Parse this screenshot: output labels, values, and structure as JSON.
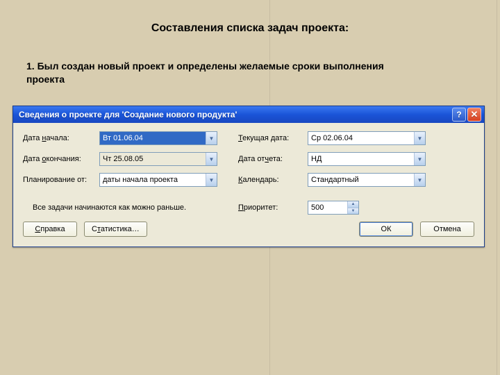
{
  "slide": {
    "title": "Составления списка задач проекта:",
    "subtitle": "1. Был создан новый проект и определены желаемые сроки выполнения проекта"
  },
  "dialog": {
    "title": "Сведения о проекте для 'Создание нового продукта'",
    "help_glyph": "?",
    "close_glyph": "✕",
    "labels": {
      "start_date_pre": "Дата ",
      "start_date_u": "н",
      "start_date_post": "ачала:",
      "end_date_pre": "Дата ",
      "end_date_u": "о",
      "end_date_post": "кончания:",
      "plan_from": "Планирование от:",
      "current_date_pre": "",
      "current_date_u": "Т",
      "current_date_post": "екущая дата:",
      "report_date_pre": "Дата от",
      "report_date_u": "ч",
      "report_date_post": "ета:",
      "calendar_u": "К",
      "calendar_post": "алендарь:",
      "priority_u": "П",
      "priority_post": "риоритет:"
    },
    "values": {
      "start_date": "Вт 01.06.04",
      "end_date": "Чт 25.08.05",
      "plan_from": "даты начала проекта",
      "current_date": "Ср 02.06.04",
      "report_date": "НД",
      "calendar": "Стандартный",
      "priority": "500"
    },
    "note": "Все задачи начинаются как можно раньше.",
    "buttons": {
      "help_u": "С",
      "help_post": "правка",
      "stats_pre": "С",
      "stats_u": "т",
      "stats_post": "атистика…",
      "ok": "ОК",
      "cancel": "Отмена"
    }
  }
}
